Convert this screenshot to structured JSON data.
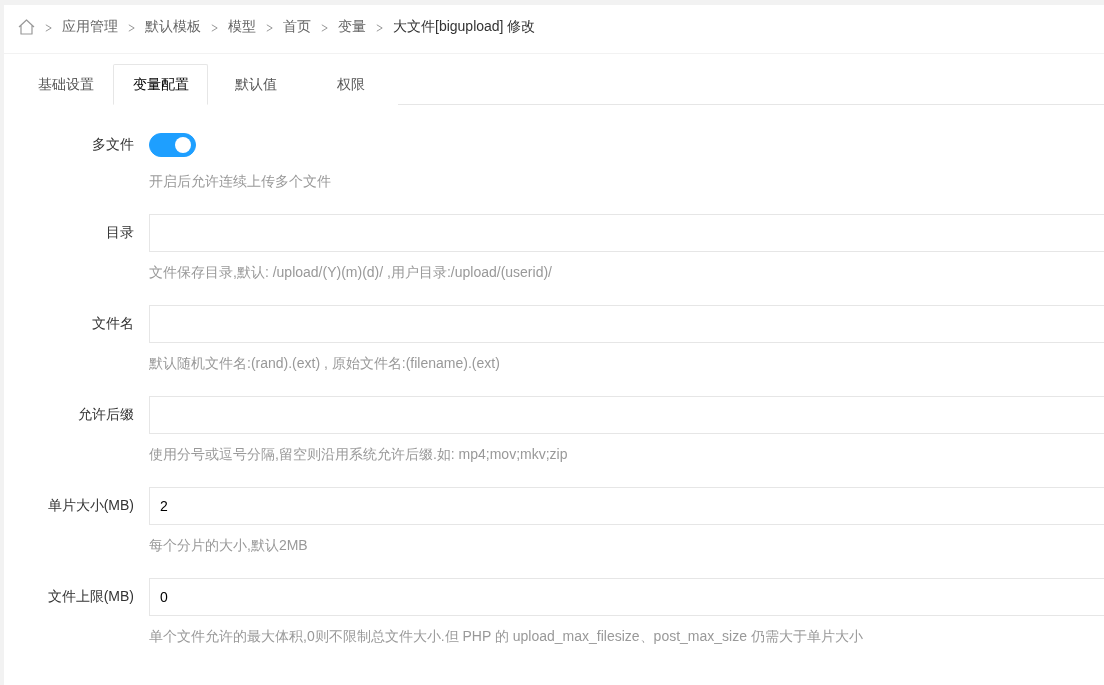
{
  "breadcrumb": {
    "items": [
      "应用管理",
      "默认模板",
      "模型",
      "首页",
      "变量"
    ],
    "current": "大文件[bigupload] 修改"
  },
  "tabs": [
    {
      "label": "基础设置",
      "selected": false
    },
    {
      "label": "变量配置",
      "selected": true
    },
    {
      "label": "默认值",
      "selected": false
    },
    {
      "label": "权限",
      "selected": false
    }
  ],
  "fields": [
    {
      "kind": "switch",
      "label": "多文件",
      "on": true,
      "hint": "开启后允许连续上传多个文件"
    },
    {
      "kind": "text",
      "label": "目录",
      "hint": "文件保存目录,默认: /upload/(Y)(m)(d)/ ,用户目录:/upload/(userid)/"
    },
    {
      "kind": "text",
      "label": "文件名",
      "hint": "默认随机文件名:(rand).(ext) , 原始文件名:(filename).(ext)"
    },
    {
      "kind": "text",
      "label": "允许后缀",
      "hint": "使用分号或逗号分隔,留空则沿用系统允许后缀.如: mp4;mov;mkv;zip"
    },
    {
      "kind": "text",
      "label": "单片大小(MB)",
      "value": "2",
      "hint": "每个分片的大小,默认2MB"
    },
    {
      "kind": "text",
      "label": "文件上限(MB)",
      "value": "0",
      "hint": "单个文件允许的最大体积,0则不限制总文件大小.但 PHP 的 upload_max_filesize、post_max_size 仍需大于单片大小"
    }
  ]
}
